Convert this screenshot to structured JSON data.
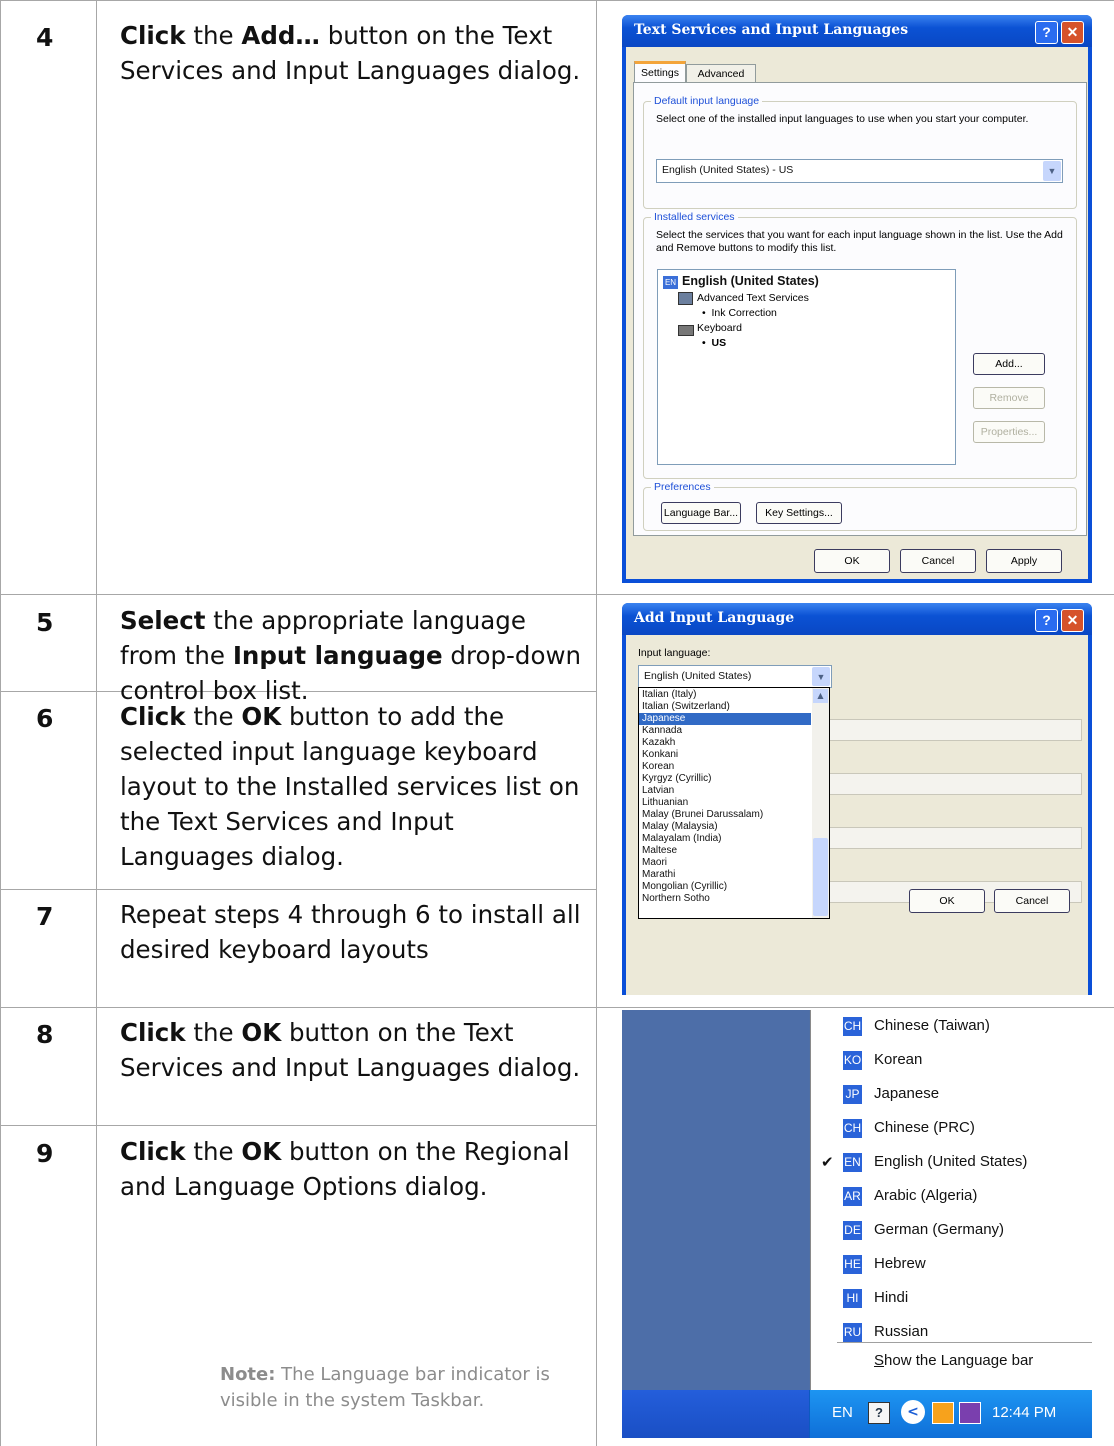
{
  "steps": [
    {
      "num": "4",
      "parts": [
        {
          "b": true,
          "t": "Click"
        },
        {
          "b": false,
          "t": " the "
        },
        {
          "b": true,
          "t": "Add…"
        },
        {
          "b": false,
          "t": " button on the Text Services and Input Languages dialog."
        }
      ]
    },
    {
      "num": "5",
      "parts": [
        {
          "b": true,
          "t": "Select"
        },
        {
          "b": false,
          "t": " the appropriate language from the "
        },
        {
          "b": true,
          "t": "Input language"
        },
        {
          "b": false,
          "t": " drop-down control box list."
        }
      ]
    },
    {
      "num": "6",
      "parts": [
        {
          "b": true,
          "t": "Click"
        },
        {
          "b": false,
          "t": " the "
        },
        {
          "b": true,
          "t": "OK"
        },
        {
          "b": false,
          "t": " button to add the selected input language keyboard layout to the Installed services list on the Text Services and Input Languages dialog."
        }
      ]
    },
    {
      "num": "7",
      "parts": [
        {
          "b": false,
          "t": "Repeat steps 4 through 6 to install all desired keyboard layouts"
        }
      ]
    },
    {
      "num": "8",
      "parts": [
        {
          "b": true,
          "t": "Click"
        },
        {
          "b": false,
          "t": " the "
        },
        {
          "b": true,
          "t": "OK"
        },
        {
          "b": false,
          "t": " button on the Text Services and Input Languages dialog."
        }
      ]
    },
    {
      "num": "9",
      "parts": [
        {
          "b": true,
          "t": "Click"
        },
        {
          "b": false,
          "t": " the "
        },
        {
          "b": true,
          "t": "OK"
        },
        {
          "b": false,
          "t": " button on the Regional and Language Options dialog."
        }
      ]
    }
  ],
  "note": {
    "label": "Note:",
    "text": " The Language bar indicator is visible in the system Taskbar."
  },
  "dialog1": {
    "title": "Text Services and Input Languages",
    "tabs": [
      "Settings",
      "Advanced"
    ],
    "default_group": "Default input language",
    "default_desc": "Select one of the installed input languages to use when you start your computer.",
    "default_value": "English (United States) - US",
    "installed_group": "Installed services",
    "installed_desc": "Select the services that you want for each input language shown in the list. Use the Add and Remove buttons to modify this list.",
    "tree": {
      "lang_code": "EN",
      "lang": "English (United States)",
      "ats": "Advanced Text Services",
      "ink": "Ink Correction",
      "keyboard": "Keyboard",
      "us": "US"
    },
    "add": "Add...",
    "remove": "Remove",
    "properties": "Properties...",
    "pref_group": "Preferences",
    "language_bar": "Language Bar...",
    "key_settings": "Key Settings...",
    "ok": "OK",
    "cancel": "Cancel",
    "apply": "Apply"
  },
  "dialog2": {
    "title": "Add Input Language",
    "input_label": "Input language:",
    "input_value": "English (United States)",
    "items": [
      "Italian (Italy)",
      "Italian (Switzerland)",
      "Japanese",
      "Kannada",
      "Kazakh",
      "Konkani",
      "Korean",
      "Kyrgyz (Cyrillic)",
      "Latvian",
      "Lithuanian",
      "Malay (Brunei Darussalam)",
      "Malay (Malaysia)",
      "Malayalam (India)",
      "Maltese",
      "Maori",
      "Marathi",
      "Mongolian (Cyrillic)",
      "Northern Sotho"
    ],
    "selected": "Japanese",
    "ok": "OK",
    "cancel": "Cancel"
  },
  "lang_menu": {
    "items": [
      {
        "code": "CH",
        "name": "Chinese (Taiwan)",
        "checked": false
      },
      {
        "code": "KO",
        "name": "Korean",
        "checked": false
      },
      {
        "code": "JP",
        "name": "Japanese",
        "checked": false
      },
      {
        "code": "CH",
        "name": "Chinese (PRC)",
        "checked": false
      },
      {
        "code": "EN",
        "name": "English (United States)",
        "checked": true
      },
      {
        "code": "AR",
        "name": "Arabic (Algeria)",
        "checked": false
      },
      {
        "code": "DE",
        "name": "German (Germany)",
        "checked": false
      },
      {
        "code": "HE",
        "name": "Hebrew",
        "checked": false
      },
      {
        "code": "HI",
        "name": "Hindi",
        "checked": false
      },
      {
        "code": "RU",
        "name": "Russian",
        "checked": false
      }
    ],
    "show_bar": "Show the Language bar",
    "taskbar_lang": "EN",
    "clock": "12:44 PM"
  }
}
